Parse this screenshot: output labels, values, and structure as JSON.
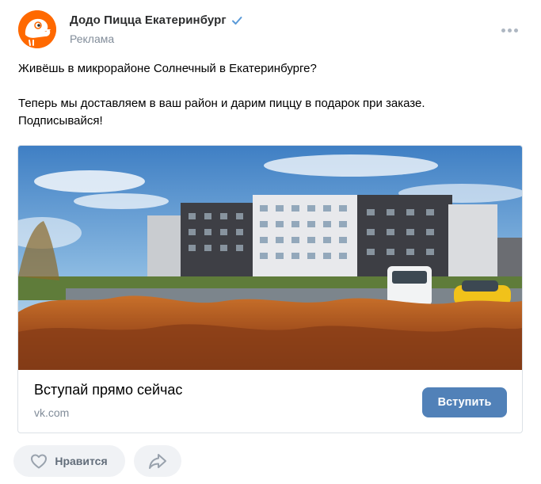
{
  "author": {
    "name": "Додо Пицца Екатеринбург",
    "subtitle": "Реклама",
    "avatar_icon": "dodo-bird-logo",
    "verified_icon": "checkmark-icon",
    "brand_color": "#ff6900"
  },
  "post": {
    "lines": [
      "Живёшь в микрорайоне Солнечный в Екатеринбурге?",
      "Теперь мы доставляем в ваш район и дарим пиццу в подарок при заказе.",
      "Подписывайся!"
    ]
  },
  "card": {
    "title": "Вступай прямо сейчас",
    "domain": "vk.com",
    "button_label": "Вступить",
    "button_color": "#5181b8"
  },
  "actions": {
    "like_label": "Нравится",
    "like_icon": "heart-icon",
    "share_icon": "share-arrow-icon"
  },
  "menu": {
    "icon": "more-dots-icon"
  }
}
